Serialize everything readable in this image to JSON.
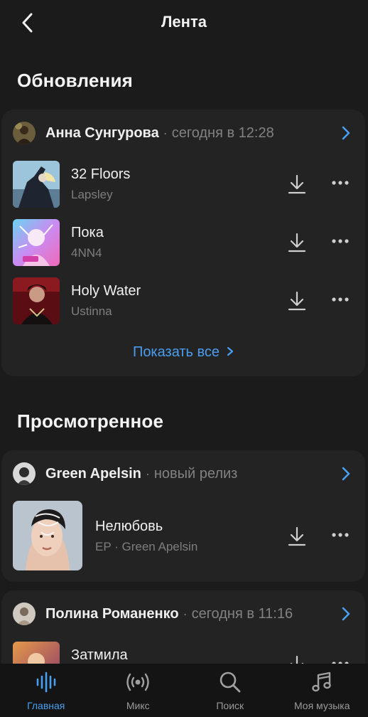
{
  "header": {
    "title": "Лента",
    "back_icon": "chevron-left-icon"
  },
  "sections": {
    "updates_title": "Обновления",
    "viewed_title": "Просмотренное"
  },
  "updates_card": {
    "author": "Анна Сунгурова",
    "separator": "·",
    "meta": "сегодня в 12:28",
    "tracks": [
      {
        "title": "32 Floors",
        "artist": "Lapsley"
      },
      {
        "title": "Пока",
        "artist": "4NN4"
      },
      {
        "title": "Holy Water",
        "artist": "Ustinna"
      }
    ],
    "show_all": "Показать все"
  },
  "release_card": {
    "author": "Green Apelsin",
    "separator": "·",
    "meta": "новый релиз",
    "track": {
      "title": "Нелюбовь",
      "subtitle": "EP · Green Apelsin"
    }
  },
  "third_card": {
    "author": "Полина Романенко",
    "separator": "·",
    "meta": "сегодня в 11:16",
    "track": {
      "title": "Затмила"
    }
  },
  "bottom_nav": {
    "items": [
      {
        "label": "Главная",
        "icon": "waveform-icon",
        "active": true
      },
      {
        "label": "Микс",
        "icon": "broadcast-icon",
        "active": false
      },
      {
        "label": "Поиск",
        "icon": "search-icon",
        "active": false
      },
      {
        "label": "Моя музыка",
        "icon": "music-note-icon",
        "active": false
      }
    ]
  },
  "colors": {
    "background": "#1b1b1b",
    "card": "#232323",
    "accent": "#4a9ef0",
    "nav_background": "#141414"
  }
}
